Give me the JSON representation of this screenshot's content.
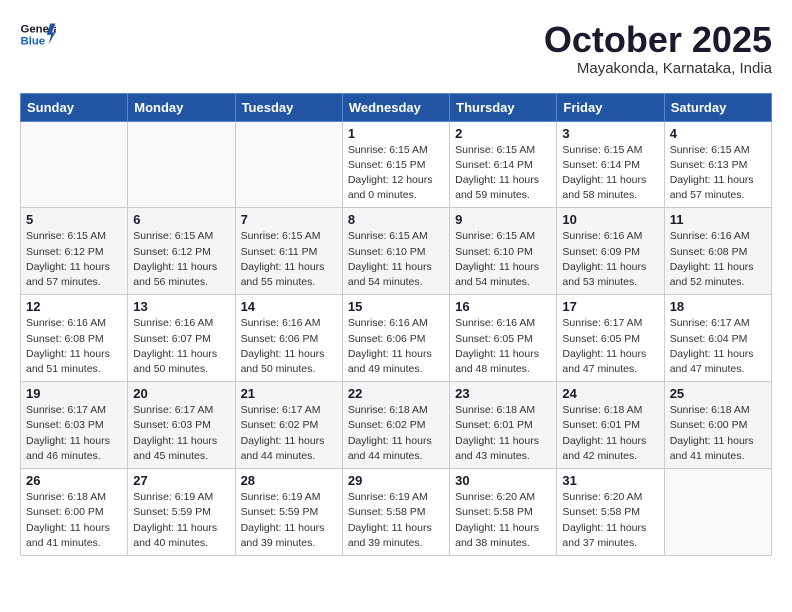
{
  "header": {
    "logo_general": "General",
    "logo_blue": "Blue",
    "month_title": "October 2025",
    "subtitle": "Mayakonda, Karnataka, India"
  },
  "weekdays": [
    "Sunday",
    "Monday",
    "Tuesday",
    "Wednesday",
    "Thursday",
    "Friday",
    "Saturday"
  ],
  "weeks": [
    [
      {
        "day": "",
        "info": ""
      },
      {
        "day": "",
        "info": ""
      },
      {
        "day": "",
        "info": ""
      },
      {
        "day": "1",
        "info": "Sunrise: 6:15 AM\nSunset: 6:15 PM\nDaylight: 12 hours\nand 0 minutes."
      },
      {
        "day": "2",
        "info": "Sunrise: 6:15 AM\nSunset: 6:14 PM\nDaylight: 11 hours\nand 59 minutes."
      },
      {
        "day": "3",
        "info": "Sunrise: 6:15 AM\nSunset: 6:14 PM\nDaylight: 11 hours\nand 58 minutes."
      },
      {
        "day": "4",
        "info": "Sunrise: 6:15 AM\nSunset: 6:13 PM\nDaylight: 11 hours\nand 57 minutes."
      }
    ],
    [
      {
        "day": "5",
        "info": "Sunrise: 6:15 AM\nSunset: 6:12 PM\nDaylight: 11 hours\nand 57 minutes."
      },
      {
        "day": "6",
        "info": "Sunrise: 6:15 AM\nSunset: 6:12 PM\nDaylight: 11 hours\nand 56 minutes."
      },
      {
        "day": "7",
        "info": "Sunrise: 6:15 AM\nSunset: 6:11 PM\nDaylight: 11 hours\nand 55 minutes."
      },
      {
        "day": "8",
        "info": "Sunrise: 6:15 AM\nSunset: 6:10 PM\nDaylight: 11 hours\nand 54 minutes."
      },
      {
        "day": "9",
        "info": "Sunrise: 6:15 AM\nSunset: 6:10 PM\nDaylight: 11 hours\nand 54 minutes."
      },
      {
        "day": "10",
        "info": "Sunrise: 6:16 AM\nSunset: 6:09 PM\nDaylight: 11 hours\nand 53 minutes."
      },
      {
        "day": "11",
        "info": "Sunrise: 6:16 AM\nSunset: 6:08 PM\nDaylight: 11 hours\nand 52 minutes."
      }
    ],
    [
      {
        "day": "12",
        "info": "Sunrise: 6:16 AM\nSunset: 6:08 PM\nDaylight: 11 hours\nand 51 minutes."
      },
      {
        "day": "13",
        "info": "Sunrise: 6:16 AM\nSunset: 6:07 PM\nDaylight: 11 hours\nand 50 minutes."
      },
      {
        "day": "14",
        "info": "Sunrise: 6:16 AM\nSunset: 6:06 PM\nDaylight: 11 hours\nand 50 minutes."
      },
      {
        "day": "15",
        "info": "Sunrise: 6:16 AM\nSunset: 6:06 PM\nDaylight: 11 hours\nand 49 minutes."
      },
      {
        "day": "16",
        "info": "Sunrise: 6:16 AM\nSunset: 6:05 PM\nDaylight: 11 hours\nand 48 minutes."
      },
      {
        "day": "17",
        "info": "Sunrise: 6:17 AM\nSunset: 6:05 PM\nDaylight: 11 hours\nand 47 minutes."
      },
      {
        "day": "18",
        "info": "Sunrise: 6:17 AM\nSunset: 6:04 PM\nDaylight: 11 hours\nand 47 minutes."
      }
    ],
    [
      {
        "day": "19",
        "info": "Sunrise: 6:17 AM\nSunset: 6:03 PM\nDaylight: 11 hours\nand 46 minutes."
      },
      {
        "day": "20",
        "info": "Sunrise: 6:17 AM\nSunset: 6:03 PM\nDaylight: 11 hours\nand 45 minutes."
      },
      {
        "day": "21",
        "info": "Sunrise: 6:17 AM\nSunset: 6:02 PM\nDaylight: 11 hours\nand 44 minutes."
      },
      {
        "day": "22",
        "info": "Sunrise: 6:18 AM\nSunset: 6:02 PM\nDaylight: 11 hours\nand 44 minutes."
      },
      {
        "day": "23",
        "info": "Sunrise: 6:18 AM\nSunset: 6:01 PM\nDaylight: 11 hours\nand 43 minutes."
      },
      {
        "day": "24",
        "info": "Sunrise: 6:18 AM\nSunset: 6:01 PM\nDaylight: 11 hours\nand 42 minutes."
      },
      {
        "day": "25",
        "info": "Sunrise: 6:18 AM\nSunset: 6:00 PM\nDaylight: 11 hours\nand 41 minutes."
      }
    ],
    [
      {
        "day": "26",
        "info": "Sunrise: 6:18 AM\nSunset: 6:00 PM\nDaylight: 11 hours\nand 41 minutes."
      },
      {
        "day": "27",
        "info": "Sunrise: 6:19 AM\nSunset: 5:59 PM\nDaylight: 11 hours\nand 40 minutes."
      },
      {
        "day": "28",
        "info": "Sunrise: 6:19 AM\nSunset: 5:59 PM\nDaylight: 11 hours\nand 39 minutes."
      },
      {
        "day": "29",
        "info": "Sunrise: 6:19 AM\nSunset: 5:58 PM\nDaylight: 11 hours\nand 39 minutes."
      },
      {
        "day": "30",
        "info": "Sunrise: 6:20 AM\nSunset: 5:58 PM\nDaylight: 11 hours\nand 38 minutes."
      },
      {
        "day": "31",
        "info": "Sunrise: 6:20 AM\nSunset: 5:58 PM\nDaylight: 11 hours\nand 37 minutes."
      },
      {
        "day": "",
        "info": ""
      }
    ]
  ]
}
